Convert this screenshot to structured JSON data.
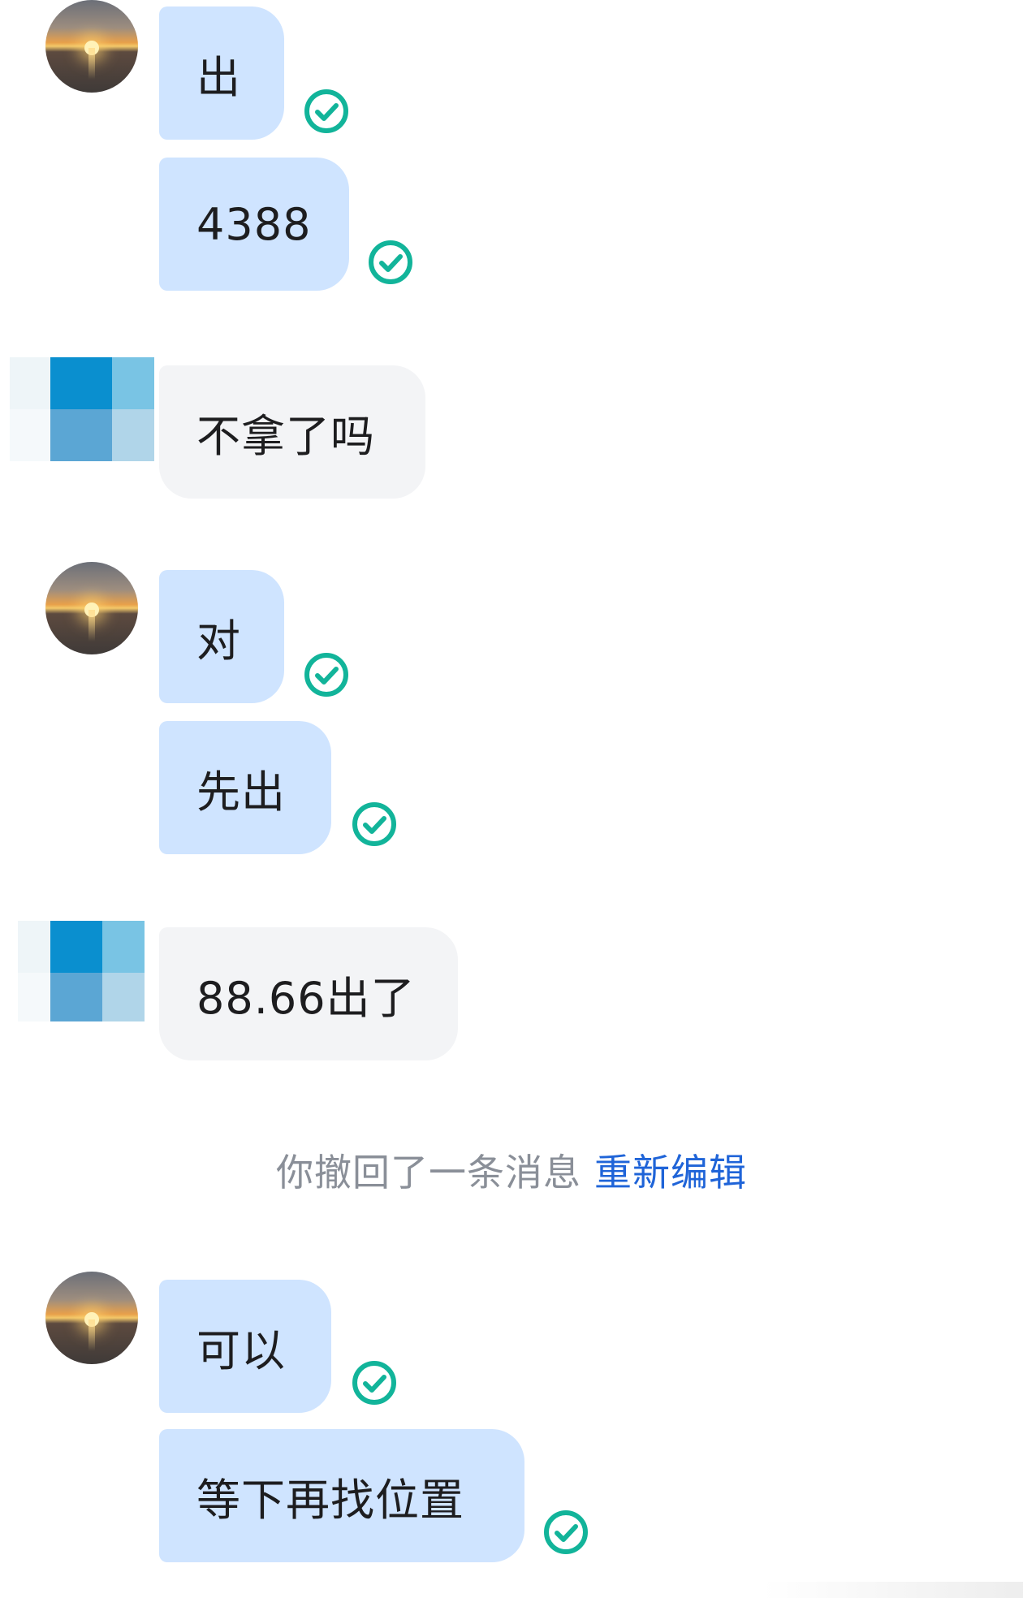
{
  "messages": [
    {
      "sender": "self",
      "text": "出",
      "status_icon": "check-circle-icon"
    },
    {
      "sender": "self",
      "text": "4388",
      "status_icon": "check-circle-icon"
    },
    {
      "sender": "other",
      "text": "不拿了吗"
    },
    {
      "sender": "self",
      "text": "对",
      "status_icon": "check-circle-icon"
    },
    {
      "sender": "self",
      "text": "先出",
      "status_icon": "check-circle-icon"
    },
    {
      "sender": "other",
      "text": "88.66出了"
    },
    {
      "sender": "self",
      "text": "可以",
      "status_icon": "check-circle-icon"
    },
    {
      "sender": "self",
      "text": "等下再找位置",
      "status_icon": "check-circle-icon"
    }
  ],
  "notice": {
    "text": "你撤回了一条消息",
    "action": "重新编辑"
  },
  "colors": {
    "self_bubble": "#cfe4ff",
    "other_bubble": "#f3f4f6",
    "check": "#12b49a",
    "link": "#1f64d8",
    "notice_text": "#8a8f98"
  },
  "icons": {
    "self_avatar": "sunset-avatar",
    "other_avatar": "blue-mosaic-avatar",
    "status": "check-circle-icon"
  }
}
